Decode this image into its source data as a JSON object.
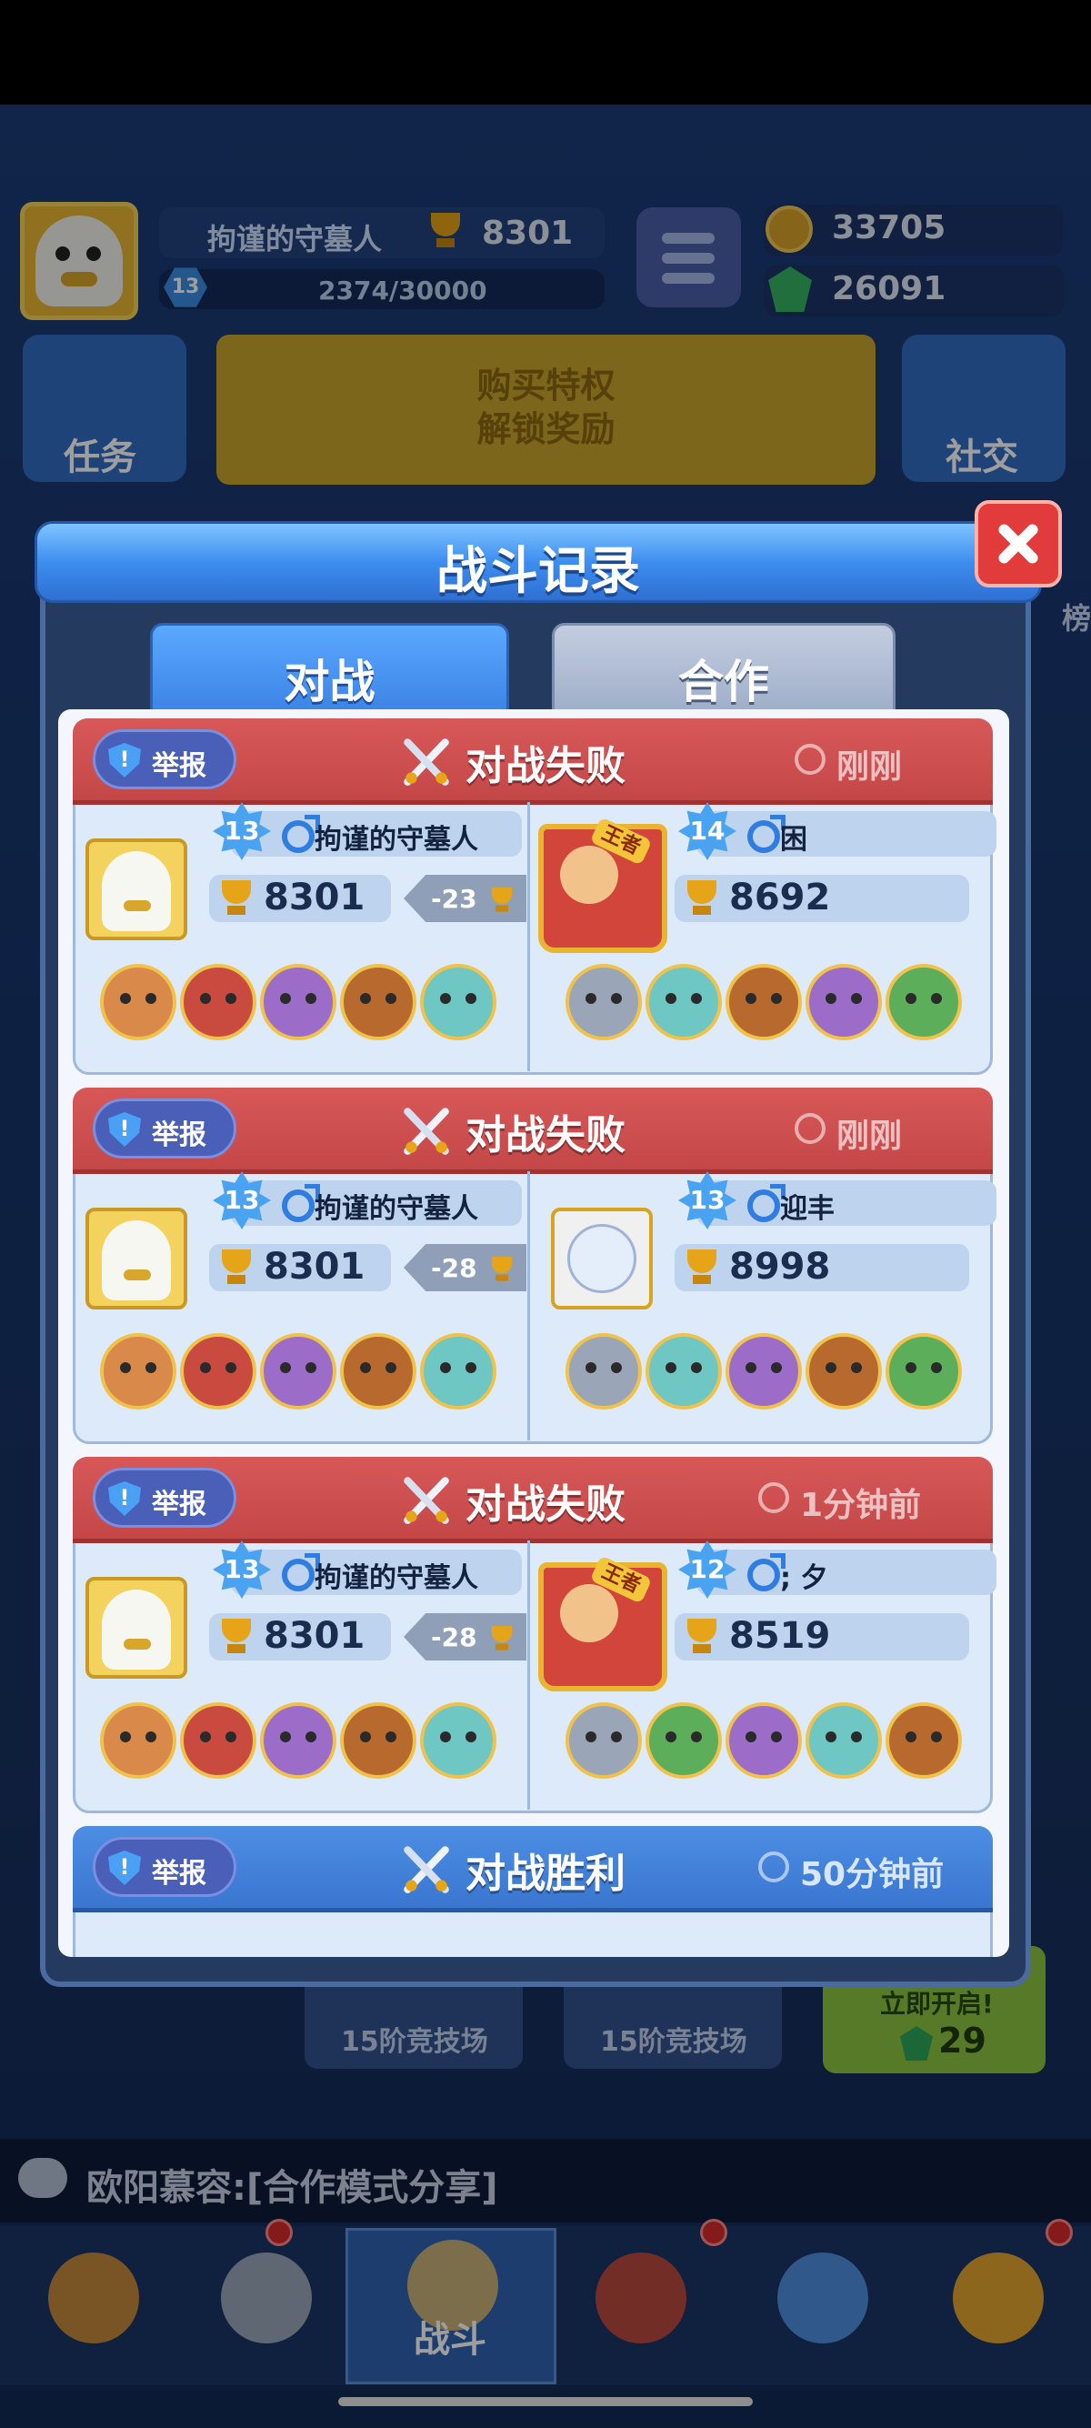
{
  "hud": {
    "player_name": "拘谨的守墓人",
    "trophies": "8301",
    "level": "13",
    "xp": "2374/30000",
    "coins": "33705",
    "gems": "26091",
    "task_label": "任务",
    "vip_line1": "购买特权",
    "vip_line2": "解锁奖励",
    "social_label": "社交",
    "side_fragment": "榜"
  },
  "modal": {
    "title": "战斗记录",
    "tabs": [
      {
        "label": "对战",
        "active": true
      },
      {
        "label": "合作",
        "active": false
      }
    ]
  },
  "records": [
    {
      "result": "对战失败",
      "outcome": "loss",
      "time": "刚刚",
      "report_label": "举报",
      "me": {
        "level": "13",
        "name": "拘谨的守墓人",
        "trophies": "8301",
        "delta": "-23"
      },
      "opponent": {
        "level": "14",
        "name": "困",
        "trophies": "8692",
        "king": true,
        "king_label": "王者"
      },
      "my_heroes": [
        "hero-brown-hair",
        "hero-red-masked",
        "hero-purple-hair",
        "hero-brown-beard",
        "hero-teal-fish"
      ],
      "opp_heroes": [
        "hero-silver-knight",
        "hero-teal-fish",
        "hero-brown-beard",
        "hero-purple-hair",
        "hero-green-cap"
      ]
    },
    {
      "result": "对战失败",
      "outcome": "loss",
      "time": "刚刚",
      "report_label": "举报",
      "me": {
        "level": "13",
        "name": "拘谨的守墓人",
        "trophies": "8301",
        "delta": "-28"
      },
      "opponent": {
        "level": "13",
        "name": "迎丰",
        "trophies": "8998",
        "king": false
      },
      "my_heroes": [
        "hero-brown-hair",
        "hero-red-masked",
        "hero-purple-hair",
        "hero-brown-beard",
        "hero-teal-fish"
      ],
      "opp_heroes": [
        "hero-silver-knight",
        "hero-teal-fish",
        "hero-purple-hair",
        "hero-brown-beard",
        "hero-green-cap"
      ]
    },
    {
      "result": "对战失败",
      "outcome": "loss",
      "time": "1分钟前",
      "report_label": "举报",
      "me": {
        "level": "13",
        "name": "拘谨的守墓人",
        "trophies": "8301",
        "delta": "-28"
      },
      "opponent": {
        "level": "12",
        "name": "; 夕",
        "trophies": "8519",
        "king": true,
        "king_label": "王者"
      },
      "my_heroes": [
        "hero-brown-hair",
        "hero-red-masked",
        "hero-purple-hair",
        "hero-brown-beard",
        "hero-teal-fish"
      ],
      "opp_heroes": [
        "hero-silver-knight",
        "hero-green-cap",
        "hero-purple-hair",
        "hero-teal-fish",
        "hero-brown-beard"
      ]
    },
    {
      "result": "对战胜利",
      "outcome": "win",
      "time": "50分钟前",
      "report_label": "举报"
    }
  ],
  "bottom": {
    "arena1": "15阶竞技场",
    "arena2": "15阶竞技场",
    "chest_open": "立即开启!",
    "chest_cost": "29",
    "chat": "欧阳慕容:[合作模式分享]",
    "battle_tab": "战斗"
  },
  "colors": {
    "loss_header": "#d85858",
    "win_header": "#4d8ee4",
    "accent_blue": "#3b82e4"
  }
}
